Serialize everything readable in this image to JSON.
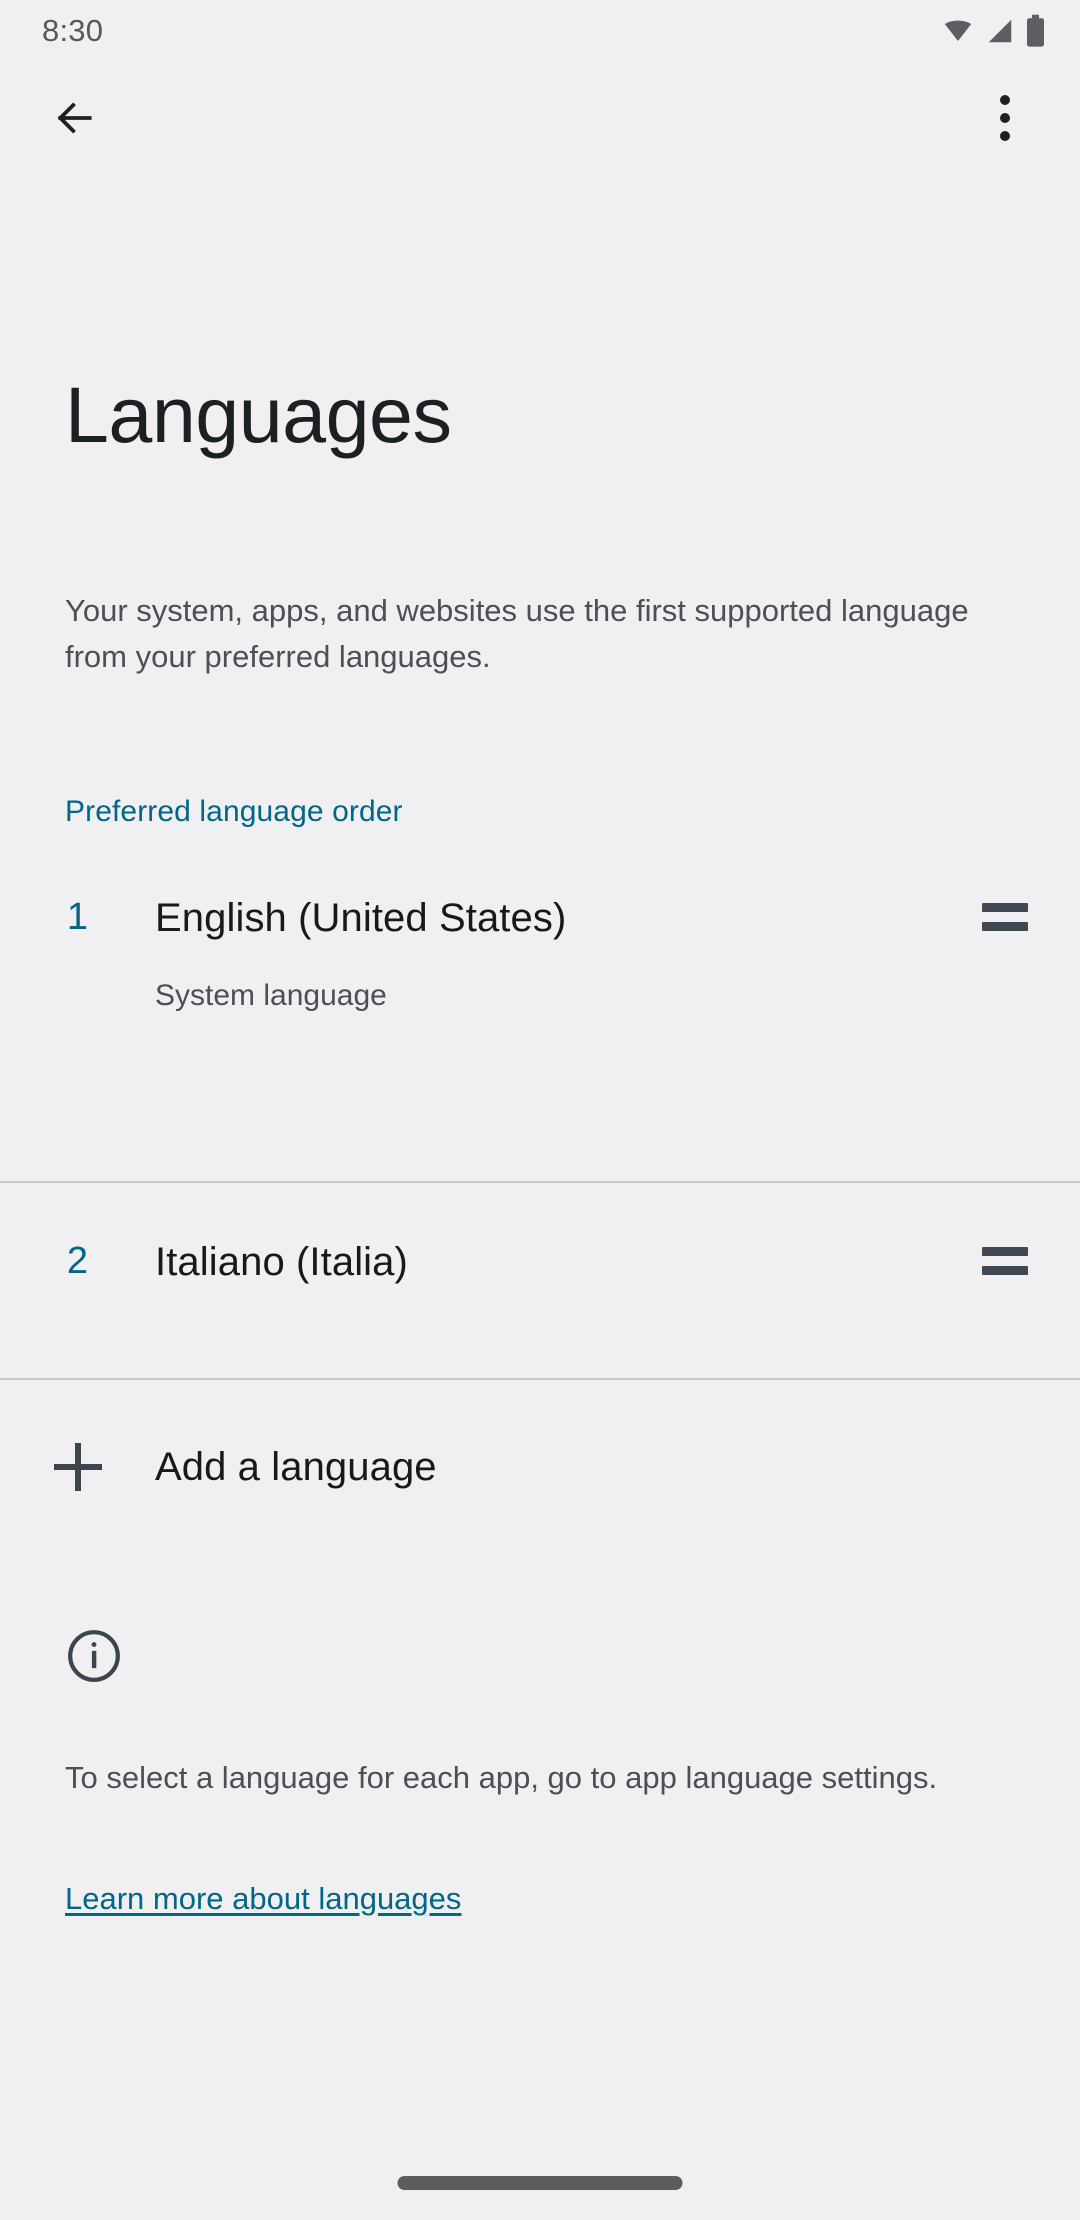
{
  "status_bar": {
    "time": "8:30",
    "icons": [
      "wifi-icon",
      "cellular-signal-icon",
      "battery-icon"
    ]
  },
  "app_bar": {
    "back_icon": "back-arrow-icon",
    "overflow_icon": "more-options-icon"
  },
  "page": {
    "title": "Languages",
    "description": "Your system, apps, and websites use the first supported language from your preferred languages."
  },
  "section": {
    "header": "Preferred language order"
  },
  "languages": [
    {
      "index": "1",
      "name": "English (United States)",
      "subtitle": "System language",
      "handle_icon": "drag-handle-icon"
    },
    {
      "index": "2",
      "name": "Italiano (Italia)",
      "subtitle": "",
      "handle_icon": "drag-handle-icon"
    }
  ],
  "add_language": {
    "icon": "plus-icon",
    "label": "Add a language"
  },
  "footer": {
    "icon": "info-circle-icon",
    "text": "To select a language for each app, go to app language settings.",
    "link": "Learn more about languages"
  },
  "navigation": {
    "pill": "gesture-nav-pill"
  },
  "colors": {
    "background": "#f0f0f2",
    "accent": "#00668b",
    "primary_text": "#17191c",
    "secondary_text": "#4b5055",
    "divider": "#c7c9cc"
  }
}
